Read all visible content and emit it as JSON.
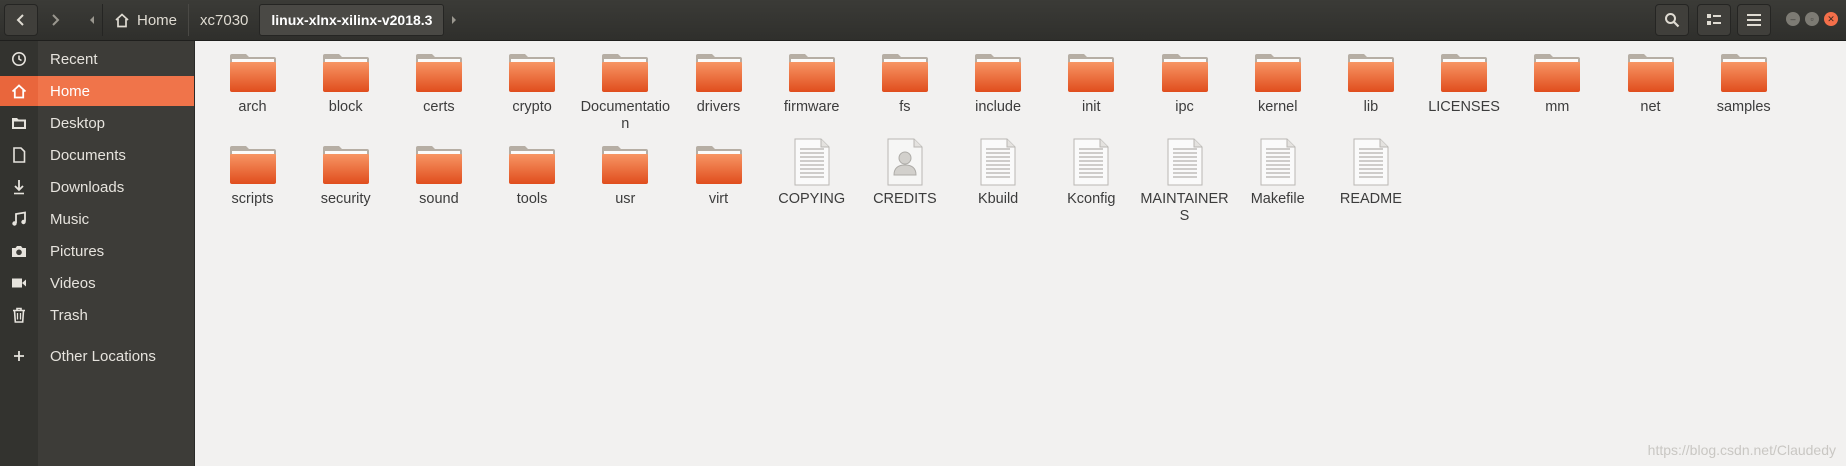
{
  "header": {
    "breadcrumbs": [
      {
        "label": "Home",
        "icon": "home-icon"
      },
      {
        "label": "xc7030"
      },
      {
        "label": "linux-xlnx-xilinx-v2018.3",
        "active": true
      }
    ]
  },
  "sidebar": {
    "items": [
      {
        "label": "Recent",
        "icon": "clock-icon"
      },
      {
        "label": "Home",
        "icon": "home-icon",
        "active": true
      },
      {
        "label": "Desktop",
        "icon": "folder-icon"
      },
      {
        "label": "Documents",
        "icon": "document-icon"
      },
      {
        "label": "Downloads",
        "icon": "download-icon"
      },
      {
        "label": "Music",
        "icon": "music-icon"
      },
      {
        "label": "Pictures",
        "icon": "camera-icon"
      },
      {
        "label": "Videos",
        "icon": "video-icon"
      },
      {
        "label": "Trash",
        "icon": "trash-icon"
      },
      {
        "label": "Other Locations",
        "icon": "plus-icon"
      }
    ]
  },
  "files": [
    {
      "name": "arch",
      "type": "folder"
    },
    {
      "name": "block",
      "type": "folder"
    },
    {
      "name": "certs",
      "type": "folder"
    },
    {
      "name": "crypto",
      "type": "folder"
    },
    {
      "name": "Documentation",
      "type": "folder"
    },
    {
      "name": "drivers",
      "type": "folder"
    },
    {
      "name": "firmware",
      "type": "folder"
    },
    {
      "name": "fs",
      "type": "folder"
    },
    {
      "name": "include",
      "type": "folder"
    },
    {
      "name": "init",
      "type": "folder"
    },
    {
      "name": "ipc",
      "type": "folder"
    },
    {
      "name": "kernel",
      "type": "folder"
    },
    {
      "name": "lib",
      "type": "folder"
    },
    {
      "name": "LICENSES",
      "type": "folder"
    },
    {
      "name": "mm",
      "type": "folder"
    },
    {
      "name": "net",
      "type": "folder"
    },
    {
      "name": "samples",
      "type": "folder"
    },
    {
      "name": "scripts",
      "type": "folder"
    },
    {
      "name": "security",
      "type": "folder"
    },
    {
      "name": "sound",
      "type": "folder"
    },
    {
      "name": "tools",
      "type": "folder"
    },
    {
      "name": "usr",
      "type": "folder"
    },
    {
      "name": "virt",
      "type": "folder"
    },
    {
      "name": "COPYING",
      "type": "text"
    },
    {
      "name": "CREDITS",
      "type": "credits"
    },
    {
      "name": "Kbuild",
      "type": "text"
    },
    {
      "name": "Kconfig",
      "type": "text"
    },
    {
      "name": "MAINTAINERS",
      "type": "text"
    },
    {
      "name": "Makefile",
      "type": "text"
    },
    {
      "name": "README",
      "type": "text"
    }
  ],
  "watermark": "https://blog.csdn.net/Claudedy",
  "colors": {
    "accent": "#f0744a",
    "folder": "#e9622f",
    "headerbar": "#35352f"
  }
}
